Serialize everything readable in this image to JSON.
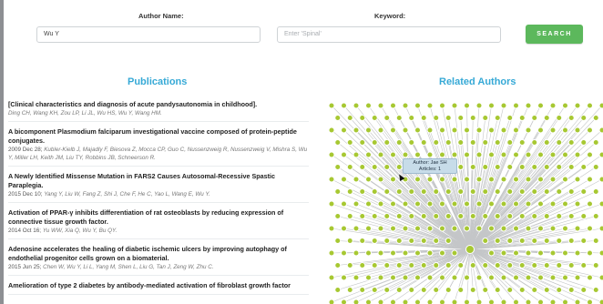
{
  "search": {
    "author_label": "Author Name:",
    "author_value": "Wu Y",
    "keyword_label": "Keyword:",
    "keyword_placeholder": "Enter 'Spinal'",
    "button_label": "SEARCH",
    "button_color": "#5cb85c"
  },
  "publications": {
    "heading": "Publications",
    "items": [
      {
        "title": "[Clinical characteristics and diagnosis of acute pandysautonomia in childhood].",
        "date": "",
        "authors": "Ding CH, Wang KH, Zou LP, Li JL, Wu HS, Wu Y, Wang HM."
      },
      {
        "title": "A bicomponent Plasmodium falciparum investigational vaccine composed of protein-peptide conjugates.",
        "date": "2009 Dec 28;",
        "authors": "Kubler-Kielb J, Majadly F, Biesova Z, Mocca CP, Guo C, Nussenzweig R, Nussenzweig V, Mishra S, Wu Y, Miller LH, Keith JM, Liu TY, Robbins JB, Schneerson R."
      },
      {
        "title": "A Newly Identified Missense Mutation in FARS2 Causes Autosomal-Recessive Spastic Paraplegia.",
        "date": "2015 Dec 10;",
        "authors": "Yang Y, Liu W, Fang Z, Shi J, Che F, He C, Yao L, Wang E, Wu Y."
      },
      {
        "title": "Activation of PPAR-γ inhibits differentiation of rat osteoblasts by reducing expression of connective tissue growth factor.",
        "date": "2014 Oct 16;",
        "authors": "Yu WW, Xia Q, Wu Y, Bu QY."
      },
      {
        "title": "Adenosine accelerates the healing of diabetic ischemic ulcers by improving autophagy of endothelial progenitor cells grown on a biomaterial.",
        "date": "2015 Jun 25;",
        "authors": "Chen W, Wu Y, Li L, Yang M, Shen L, Liu G, Tan J, Zeng W, Zhu C."
      },
      {
        "title": "Amelioration of type 2 diabetes by antibody-mediated activation of fibroblast growth factor",
        "date": "",
        "authors": ""
      }
    ]
  },
  "related": {
    "heading": "Related Authors",
    "tooltip_line1": "Author: Jae SH",
    "tooltip_line2": "Articles: 1",
    "node_color": "#a7c832",
    "edge_color": "#c4c6c8"
  }
}
